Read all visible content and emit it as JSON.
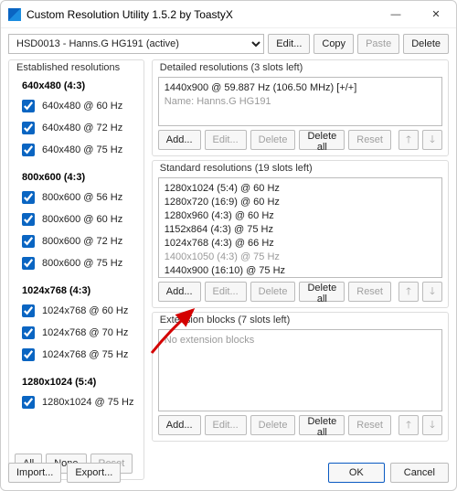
{
  "title": "Custom Resolution Utility 1.5.2 by ToastyX",
  "monitor": {
    "selected": "HSD0013 - Hanns.G HG191 (active)"
  },
  "topButtons": {
    "edit": "Edit...",
    "copy": "Copy",
    "paste": "Paste",
    "delete": "Delete"
  },
  "established": {
    "title": "Established resolutions",
    "groups": [
      {
        "head": "640x480 (4:3)",
        "items": [
          "640x480 @ 60 Hz",
          "640x480 @ 72 Hz",
          "640x480 @ 75 Hz"
        ]
      },
      {
        "head": "800x600 (4:3)",
        "items": [
          "800x600 @ 56 Hz",
          "800x600 @ 60 Hz",
          "800x600 @ 72 Hz",
          "800x600 @ 75 Hz"
        ]
      },
      {
        "head": "1024x768 (4:3)",
        "items": [
          "1024x768 @ 60 Hz",
          "1024x768 @ 70 Hz",
          "1024x768 @ 75 Hz"
        ]
      },
      {
        "head": "1280x1024 (5:4)",
        "items": [
          "1280x1024 @ 75 Hz"
        ]
      }
    ],
    "footer": {
      "all": "All",
      "none": "None",
      "reset": "Reset"
    }
  },
  "detailed": {
    "title": "Detailed resolutions (3 slots left)",
    "line1": "1440x900 @ 59.887 Hz (106.50 MHz) [+/+]",
    "line2": "Name: Hanns.G HG191"
  },
  "standard": {
    "title": "Standard resolutions (19 slots left)",
    "items": [
      "1280x1024 (5:4) @ 60 Hz",
      "1280x720 (16:9) @ 60 Hz",
      "1280x960 (4:3) @ 60 Hz",
      "1152x864 (4:3) @ 75 Hz",
      "1024x768 (4:3) @ 66 Hz",
      "1400x1050 (4:3) @ 75 Hz",
      "1440x900 (16:10) @ 75 Hz"
    ]
  },
  "extension": {
    "title": "Extension blocks (7 slots left)",
    "empty": "No extension blocks"
  },
  "panelButtons": {
    "add": "Add...",
    "edit": "Edit...",
    "delete": "Delete",
    "deleteAll": "Delete all",
    "reset": "Reset",
    "up": "🡑",
    "down": "🡓"
  },
  "bottom": {
    "import": "Import...",
    "export": "Export...",
    "ok": "OK",
    "cancel": "Cancel"
  }
}
